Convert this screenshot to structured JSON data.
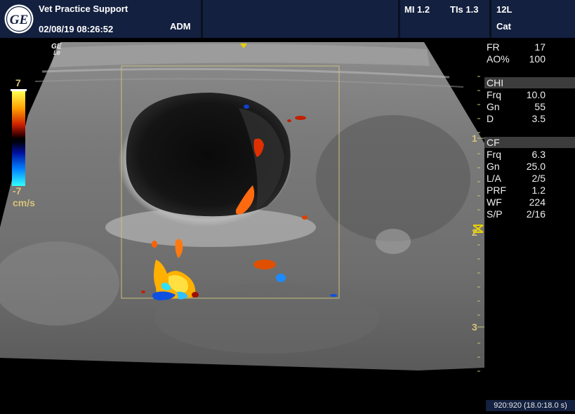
{
  "header": {
    "title": "Vet Practice Support",
    "datetime": "02/08/19 08:26:52",
    "user": "ADM",
    "mi": "MI 1.2",
    "tis": "TIs 1.3",
    "probe": "12L",
    "preset": "Cat",
    "logo_text": "GE"
  },
  "overlay": {
    "brand_mark": "GE",
    "brand_sub": "Le",
    "color_scale_top": "7",
    "color_scale_bottom": "-7",
    "color_scale_unit": "cm/s",
    "depth_marks": [
      "1",
      "2",
      "3"
    ],
    "focus_marker": "focus-zone-marker-icon",
    "colors": {
      "header_bg": "#13203f",
      "depth_text": "#d8c27a",
      "roi_box": "#c8c080"
    }
  },
  "params_top": [
    {
      "k": "FR",
      "v": "17"
    },
    {
      "k": "AO%",
      "v": "100"
    }
  ],
  "sections": [
    {
      "title": "CHI",
      "rows": [
        {
          "k": "Frq",
          "v": "10.0"
        },
        {
          "k": "Gn",
          "v": "55"
        },
        {
          "k": "D",
          "v": "3.5"
        }
      ]
    },
    {
      "title": "CF",
      "rows": [
        {
          "k": "Frq",
          "v": "6.3"
        },
        {
          "k": "Gn",
          "v": "25.0"
        },
        {
          "k": "L/A",
          "v": "2/5"
        },
        {
          "k": "PRF",
          "v": "1.2"
        },
        {
          "k": "WF",
          "v": "224"
        },
        {
          "k": "S/P",
          "v": "2/16"
        }
      ]
    }
  ],
  "footer": "920:920 (18.0:18.0 s)"
}
